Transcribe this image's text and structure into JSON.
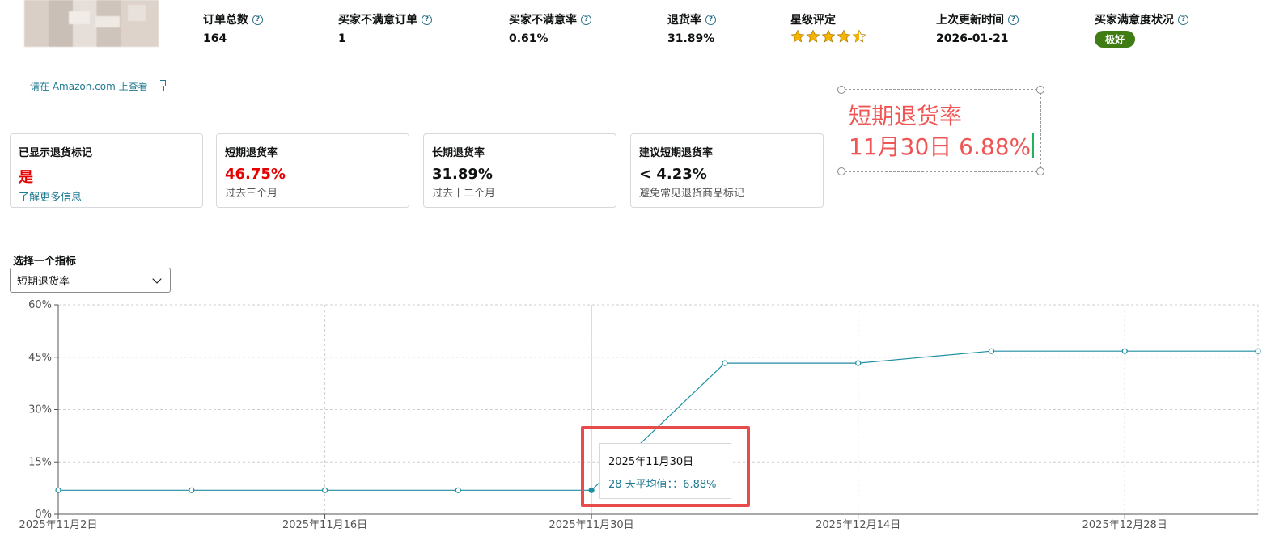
{
  "metrics": [
    {
      "label": "订单总数",
      "value": "164"
    },
    {
      "label": "买家不满意订单",
      "value": "1"
    },
    {
      "label": "买家不满意率",
      "value": "0.61%"
    },
    {
      "label": "退货率",
      "value": "31.89%"
    },
    {
      "label": "星级评定",
      "rating": 4.5,
      "rating_max": 5
    },
    {
      "label": "上次更新时间",
      "value": "2026-01-21"
    },
    {
      "label": "买家满意度状况",
      "badge": "极好"
    }
  ],
  "amazon_link": "请在 Amazon.com 上查看",
  "cards": [
    {
      "title": "已显示退货标记",
      "value": "是",
      "link": "了解更多信息"
    },
    {
      "title": "短期退货率",
      "value": "46.75%",
      "sub": "过去三个月"
    },
    {
      "title": "长期退货率",
      "value": "31.89%",
      "sub": "过去十二个月"
    },
    {
      "title": "建议短期退货率",
      "value": "< 4.23%",
      "sub": "避免常见退货商品标记"
    }
  ],
  "annotation": {
    "line1": "短期退货率",
    "line2": "11月30日 6.88%"
  },
  "metric_select": {
    "label": "选择一个指标",
    "value": "短期退货率"
  },
  "tooltip": {
    "date": "2025年11月30日",
    "value": "28 天平均值：：6.88%"
  },
  "colors": {
    "line": "#1f8ea3",
    "red": "#e84b4b",
    "badge": "#3f7d14",
    "link": "#1f7a92",
    "value_red": "#e60000"
  },
  "chart_data": {
    "type": "line",
    "series": [
      {
        "points": [
          {
            "x": "2025-11-02",
            "y": 6.88
          },
          {
            "x": "2025-11-09",
            "y": 6.88
          },
          {
            "x": "2025-11-16",
            "y": 6.88
          },
          {
            "x": "2025-11-23",
            "y": 6.88
          },
          {
            "x": "2025-11-30",
            "y": 6.88
          },
          {
            "x": "2025-12-07",
            "y": 43.3
          },
          {
            "x": "2025-12-14",
            "y": 43.3
          },
          {
            "x": "2025-12-21",
            "y": 46.75
          },
          {
            "x": "2025-12-28",
            "y": 46.75
          },
          {
            "x": "2026-01-04",
            "y": 46.75
          }
        ]
      }
    ],
    "ylim": [
      0,
      60
    ],
    "y_ticks": [
      "0%",
      "15%",
      "30%",
      "45%",
      "60%"
    ],
    "x_ticks": [
      {
        "x": "2025-11-02",
        "label": "2025年11月2日"
      },
      {
        "x": "2025-11-16",
        "label": "2025年11月16日"
      },
      {
        "x": "2025-11-30",
        "label": "2025年11月30日"
      },
      {
        "x": "2025-12-14",
        "label": "2025年12月14日"
      },
      {
        "x": "2025-12-28",
        "label": "2025年12月28日"
      }
    ],
    "x_range": [
      "2025-11-02",
      "2026-01-04"
    ],
    "highlight_x": "2025-11-30",
    "grid": true
  }
}
